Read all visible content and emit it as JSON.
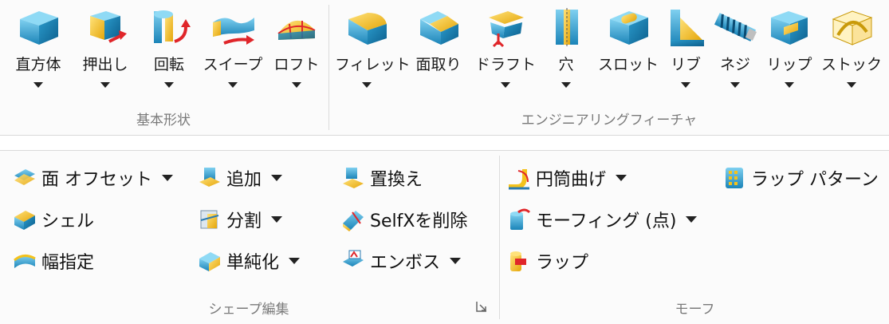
{
  "top_ribbon": {
    "basic_shapes": {
      "label": "基本形状",
      "buttons": [
        "直方体",
        "押出し",
        "回転",
        "スイープ",
        "ロフト"
      ]
    },
    "engineering_features": {
      "label": "エンジニアリングフィーチャ",
      "buttons": [
        "フィレット",
        "面取り",
        "ドラフト",
        "穴",
        "スロット",
        "リブ",
        "ネジ",
        "リップ",
        "ストック"
      ]
    }
  },
  "bottom_ribbon": {
    "shape_edit": {
      "label": "シェープ編集",
      "col1": [
        "面 オフセット",
        "シェル",
        "幅指定"
      ],
      "col2": [
        "追加",
        "分割",
        "単純化"
      ],
      "col3": [
        "置換え",
        "SelfXを削除",
        "エンボス"
      ]
    },
    "morph": {
      "label": "モーフ",
      "col1": [
        "円筒曲げ",
        "モーフィング (点)",
        "ラップ"
      ],
      "col2": [
        "ラップ パターン"
      ]
    }
  },
  "colors": {
    "face_blue": "#3aa6d6",
    "face_yellow": "#f4c21c",
    "accent_red": "#e0262a"
  }
}
